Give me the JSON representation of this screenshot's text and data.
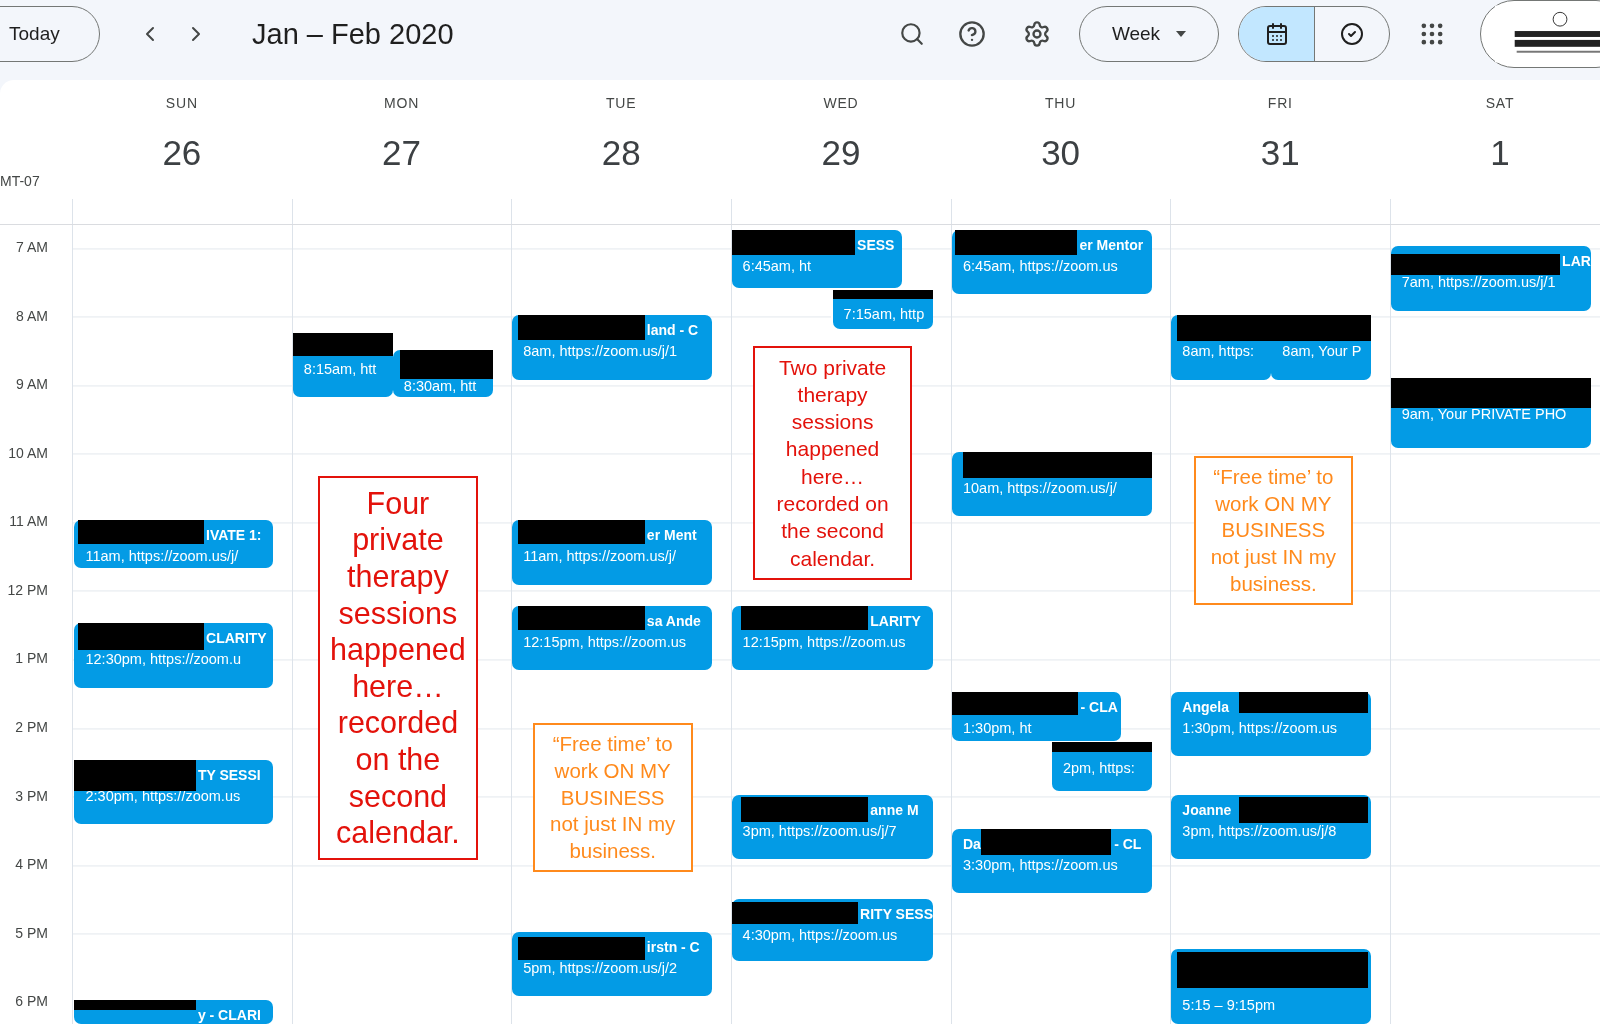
{
  "toolbar": {
    "today": "Today",
    "title": "Jan – Feb 2020",
    "view": "Week",
    "view_toggle": [
      {
        "kind": "calendar",
        "selected": true
      },
      {
        "kind": "tasks",
        "selected": false
      }
    ]
  },
  "timezone": "MT-07",
  "hours": [
    "7 AM",
    "8 AM",
    "9 AM",
    "10 AM",
    "11 AM",
    "12 PM",
    "1 PM",
    "2 PM",
    "3 PM",
    "4 PM",
    "5 PM",
    "6 PM"
  ],
  "days": [
    {
      "name": "SUN",
      "date": "26",
      "events": [
        {
          "title": "IVATE 1:",
          "time": "11am, https://zoom.us/j/",
          "redacted": true
        },
        {
          "title": "CLARITY",
          "time": "12:30pm, https://zoom.u",
          "redacted": true
        },
        {
          "title": "TY SESSI",
          "time": "2:30pm, https://zoom.us",
          "redacted": true
        },
        {
          "title": "y - CLARI",
          "redacted": true
        }
      ]
    },
    {
      "name": "MON",
      "date": "27",
      "events": [
        {
          "time": "8:15am, htt",
          "redacted": true
        },
        {
          "time": "8:30am, htt",
          "redacted": true
        }
      ],
      "notes": [
        {
          "text": "Four private therapy sessions happened here… recorded on the second calendar.",
          "color": "#e3120b"
        }
      ]
    },
    {
      "name": "TUE",
      "date": "28",
      "events": [
        {
          "title": "land - C",
          "time": "8am, https://zoom.us/j/1",
          "redacted": true
        },
        {
          "title": "er Ment",
          "time": "11am, https://zoom.us/j/",
          "redacted": true
        },
        {
          "title": "sa Ande",
          "time": "12:15pm, https://zoom.us",
          "redacted": true
        },
        {
          "title": "irstn - C",
          "time": "5pm, https://zoom.us/j/2",
          "redacted": true
        }
      ],
      "notes": [
        {
          "text": "“Free time’ to work ON MY BUSINESS not just IN my business.",
          "color": "#ff8a1c"
        }
      ]
    },
    {
      "name": "WED",
      "date": "29",
      "events": [
        {
          "title": "SESS",
          "time": "6:45am, ht",
          "redacted": true
        },
        {
          "time": "7:15am, http",
          "redacted": true
        },
        {
          "title": "LARITY",
          "time": "12:15pm, https://zoom.us",
          "redacted": true
        },
        {
          "title": "anne M",
          "time": "3pm, https://zoom.us/j/7",
          "redacted": true
        },
        {
          "title": "RITY SESS",
          "time": "4:30pm, https://zoom.us",
          "redacted": true
        }
      ],
      "notes": [
        {
          "text": "Two private therapy sessions happened here… recorded on the second calendar.",
          "color": "#e3120b"
        }
      ]
    },
    {
      "name": "THU",
      "date": "30",
      "events": [
        {
          "title": "er Mentor",
          "time": "6:45am, https://zoom.us",
          "redacted": true
        },
        {
          "time": "10am, https://zoom.us/j/",
          "redacted": true
        },
        {
          "title": "- CLA",
          "time": "1:30pm, ht",
          "redacted": true
        },
        {
          "time": "2pm, https:",
          "redacted": true
        },
        {
          "title": "Da",
          "title_after": "- CL",
          "time": "3:30pm, https://zoom.us",
          "redacted": true
        }
      ]
    },
    {
      "name": "FRI",
      "date": "31",
      "events": [
        {
          "time": "8am, https:",
          "redacted": true
        },
        {
          "time": "8am, Your P",
          "redacted": true
        },
        {
          "title": "Angela",
          "time": "1:30pm, https://zoom.us",
          "redacted": true
        },
        {
          "title": "Joanne",
          "time": "3pm, https://zoom.us/j/8",
          "redacted": true
        },
        {
          "time": "5:15 – 9:15pm",
          "redacted": true
        }
      ],
      "notes": [
        {
          "text": "“Free time’ to work ON MY BUSINESS not just IN my business.",
          "color": "#ff8a1c"
        }
      ]
    },
    {
      "name": "SAT",
      "date": "1",
      "events": [
        {
          "title": "LAR",
          "time": "7am, https://zoom.us/j/1",
          "redacted": true
        },
        {
          "time": "9am, Your PRIVATE PHO",
          "redacted": true
        }
      ]
    }
  ]
}
